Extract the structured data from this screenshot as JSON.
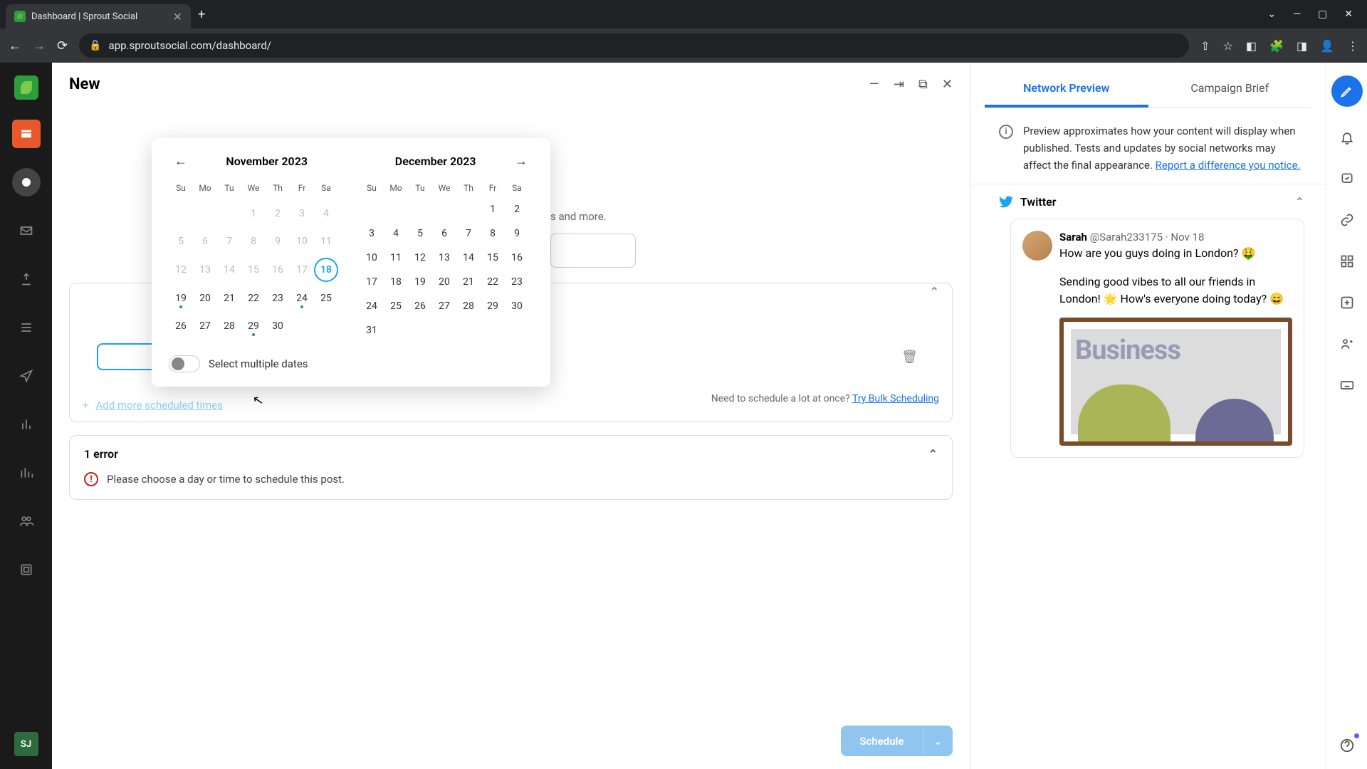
{
  "browser": {
    "tab_title": "Dashboard | Sprout Social",
    "url": "app.sproutsocial.com/dashboard/"
  },
  "header": {
    "title": "New"
  },
  "calendar": {
    "month_left": "November 2023",
    "month_right": "December 2023",
    "dows": [
      "Su",
      "Mo",
      "Tu",
      "We",
      "Th",
      "Fr",
      "Sa"
    ],
    "today": 18,
    "dots_nov": [
      19,
      24,
      29
    ],
    "toggle_label": "Select multiple dates"
  },
  "behind": {
    "text_fragment": "s and more."
  },
  "schedule_section": {
    "add_more": "Add more scheduled times",
    "bulk_prompt": "Need to schedule a lot at once?",
    "bulk_link": "Try Bulk Scheduling"
  },
  "errors": {
    "heading": "1 error",
    "msg": "Please choose a day or time to schedule this post."
  },
  "footer": {
    "schedule_btn": "Schedule"
  },
  "preview": {
    "tabs": {
      "network": "Network Preview",
      "campaign": "Campaign Brief"
    },
    "info": "Preview approximates how your content will display when published. Tests and updates by social networks may affect the final appearance. ",
    "info_link": "Report a difference you notice.",
    "network": "Twitter",
    "tweet": {
      "author": "Sarah",
      "handle": "@Sarah233175",
      "date": "Nov 18",
      "line1": "How are you guys doing in London? 🤑",
      "line2": "Sending good vibes to all our friends in London! 🌟 How's everyone doing today? 😄",
      "img_text": "Business"
    }
  },
  "rail_avatar": "SJ"
}
